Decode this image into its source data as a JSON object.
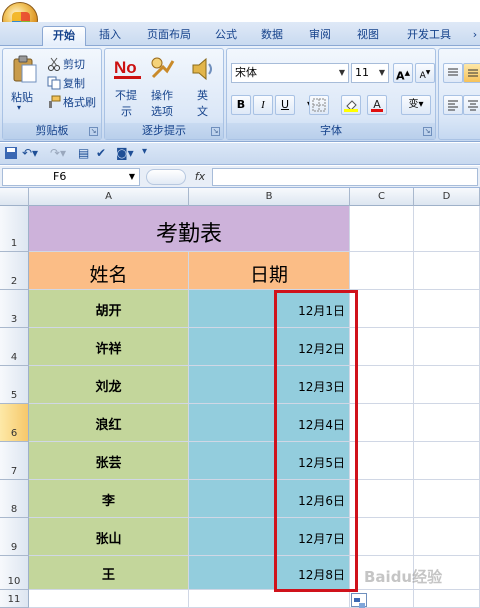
{
  "tabs": [
    "开始",
    "插入",
    "页面布局",
    "公式",
    "数据",
    "审阅",
    "视图",
    "开发工具"
  ],
  "ribbon": {
    "clipboard": {
      "paste": "粘贴",
      "cut": "剪切",
      "copy": "复制",
      "format_painter": "格式刷",
      "label": "剪贴板"
    },
    "progressive": {
      "no_label_1": "不提",
      "no_label_2": "示",
      "steps_1": "操作",
      "steps_2": "选项",
      "english_1": "英",
      "english_2": "文",
      "label": "逐步提示"
    },
    "font": {
      "name": "宋体",
      "size": "11",
      "grow": "A",
      "shrink": "A",
      "bold": "B",
      "italic": "I",
      "underline": "U",
      "font_color": "A",
      "phonetic": "变",
      "label": "字体"
    }
  },
  "formula_bar": {
    "cell_ref": "F6",
    "fx": "fx"
  },
  "columns": [
    "A",
    "B",
    "C",
    "D"
  ],
  "rows": [
    "1",
    "2",
    "3",
    "4",
    "5",
    "6",
    "7",
    "8",
    "9",
    "10",
    "11"
  ],
  "sheet": {
    "title": "考勤表",
    "header_name": "姓名",
    "header_date": "日期",
    "names": [
      "胡开",
      "许祥",
      "刘龙",
      "浪红",
      "张芸",
      "李",
      "张山",
      "王"
    ],
    "dates": [
      "12月1日",
      "12月2日",
      "12月3日",
      "12月4日",
      "12月5日",
      "12月6日",
      "12月7日",
      "12月8日"
    ]
  },
  "colors": {
    "title_bg": "#cdb2da",
    "header_bg": "#fbbd86",
    "name_bg": "#c3d69b",
    "date_bg": "#93cddd",
    "highlight": "#d0121b"
  },
  "watermark": "Baidu经验"
}
